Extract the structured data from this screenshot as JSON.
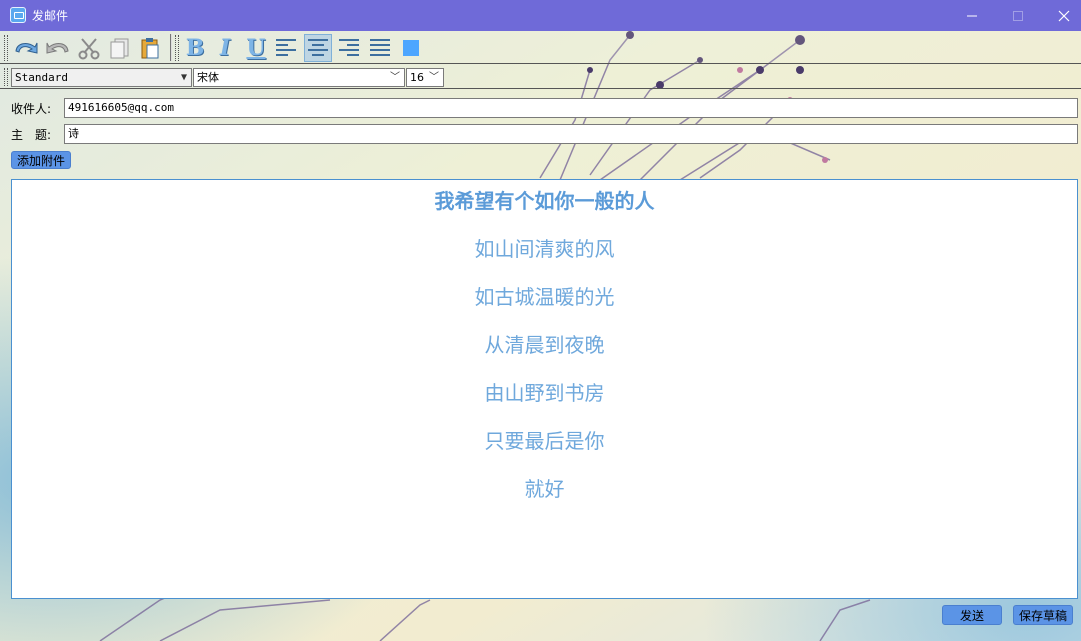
{
  "window": {
    "title": "发邮件",
    "accent_color": "#6f6ad8"
  },
  "toolbar": {
    "icons": [
      "undo-icon",
      "redo-icon",
      "cut-icon",
      "copy-icon",
      "paste-icon",
      "bold-icon",
      "italic-icon",
      "underline-icon",
      "align-left-icon",
      "align-center-icon",
      "align-right-icon",
      "justify-icon",
      "text-color-icon"
    ],
    "bold_label": "B",
    "italic_label": "I",
    "underline_label": "U",
    "active_alignment": "center",
    "text_color": "#4da6ff"
  },
  "format_bar": {
    "style_value": "Standard",
    "font_value": "宋体",
    "size_value": "16"
  },
  "form": {
    "to_label": "收件人:",
    "to_value": "491616605@qq.com",
    "subject_label": "主　题:",
    "subject_value": "诗",
    "attach_label": "添加附件"
  },
  "editor": {
    "lines": [
      "我希望有个如你一般的人",
      "如山间清爽的风",
      "如古城温暖的光",
      "从清晨到夜晚",
      "由山野到书房",
      "只要最后是你",
      "就好"
    ]
  },
  "actions": {
    "send_label": "发送",
    "draft_label": "保存草稿"
  }
}
